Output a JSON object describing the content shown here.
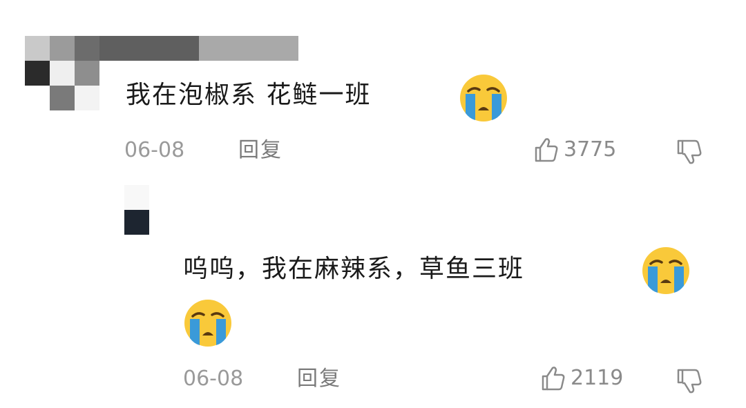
{
  "comments": [
    {
      "text": "我在泡椒系 花鲢一班",
      "emoji": "loudly-crying-face",
      "date": "06-08",
      "reply_label": "回复",
      "likes": "3775"
    },
    {
      "text": "呜呜，我在麻辣系，草鱼三班",
      "emoji": "loudly-crying-face",
      "date": "06-08",
      "reply_label": "回复",
      "likes": "2119"
    }
  ],
  "colors": {
    "text": "#1a1a1a",
    "meta": "#9a9a9a",
    "icon": "#8a8a8a",
    "emoji_face": "#f9c93a",
    "emoji_tears": "#3a9ad9"
  }
}
